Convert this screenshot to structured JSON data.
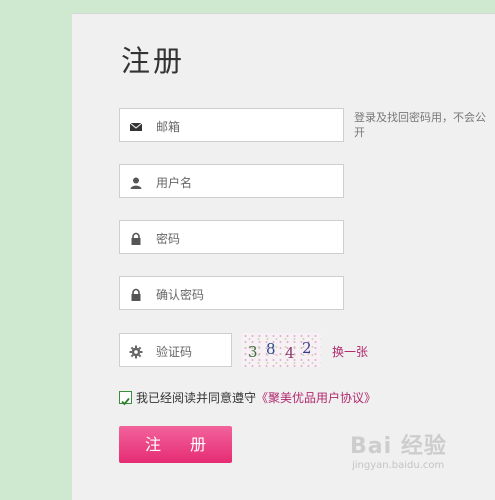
{
  "page": {
    "title": "注册"
  },
  "form": {
    "email_placeholder": "邮箱",
    "email_hint": "登录及找回密码用，不会公开",
    "username_placeholder": "用户名",
    "password_placeholder": "密码",
    "confirm_placeholder": "确认密码",
    "captcha_placeholder": "验证码",
    "captcha_chars": [
      "3",
      "8",
      "4",
      "2"
    ],
    "captcha_refresh_label": "换一张",
    "agree_prefix": "我已经阅读并同意遵守",
    "agree_link": "《聚美优品用户协议》",
    "submit_label": "注 册"
  },
  "watermark": {
    "brand": "Bai 经验",
    "url": "jingyan.baidu.com"
  },
  "colors": {
    "accent": "#e52c73",
    "link": "#b02a6e",
    "rail": "#cfe9d1"
  }
}
